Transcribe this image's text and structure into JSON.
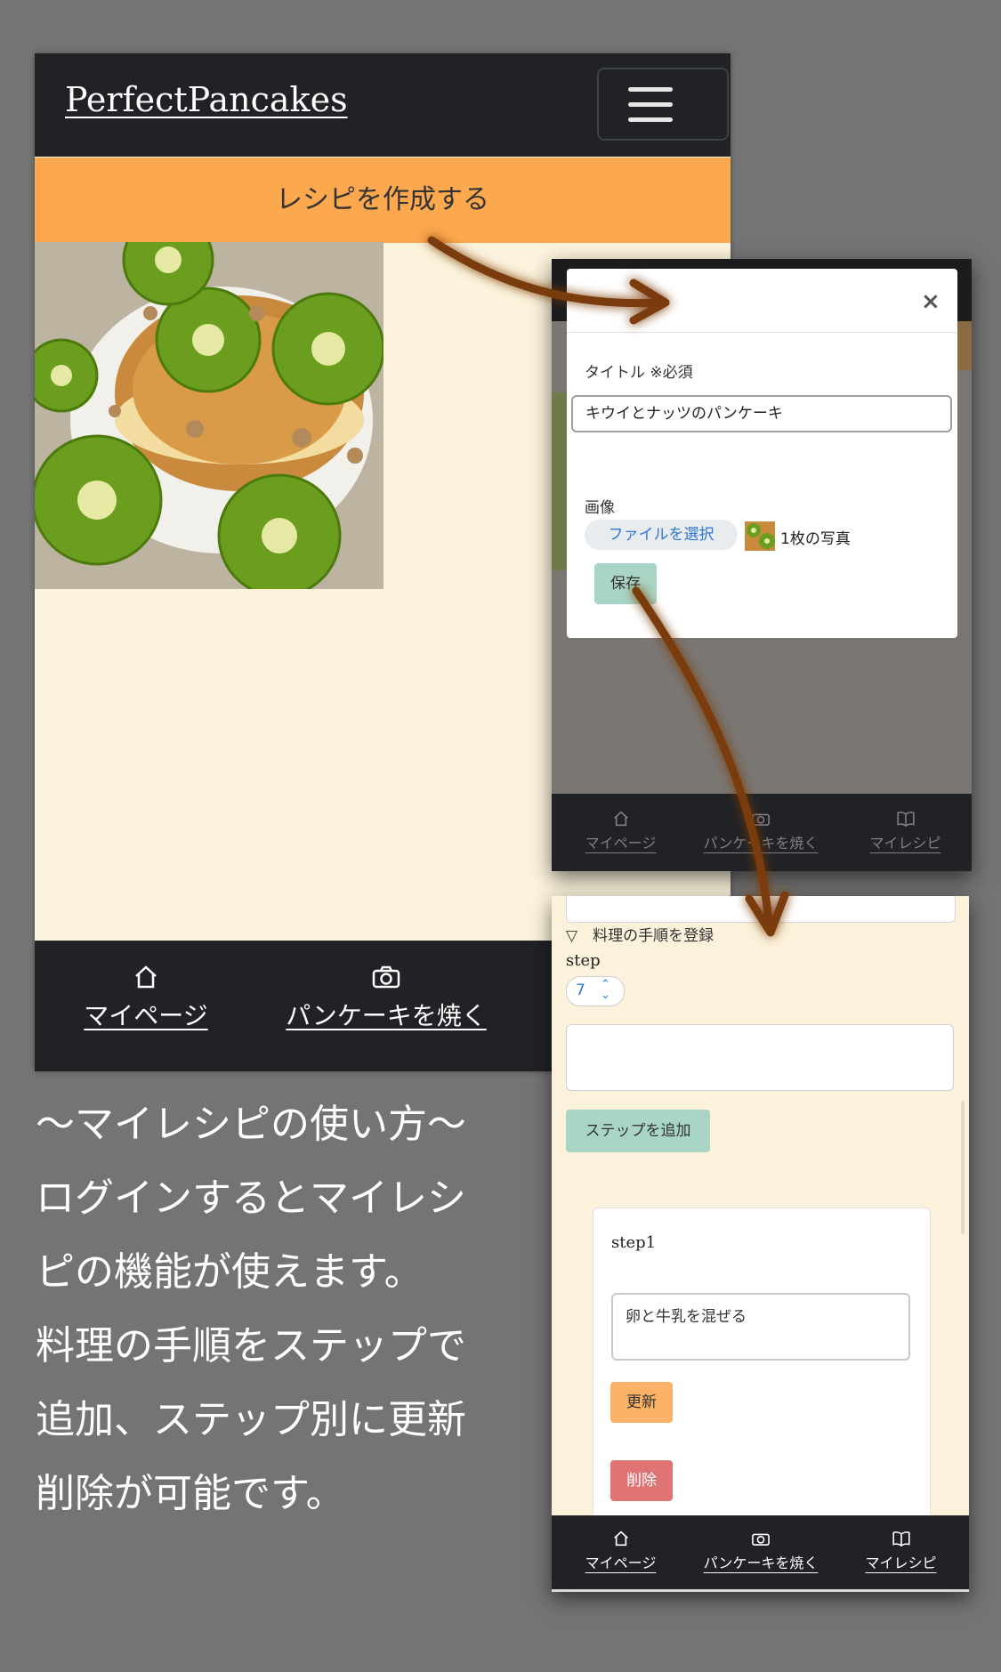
{
  "phone1": {
    "brand": "PerfectPancakes",
    "create_button": "レシピを作成する",
    "bottom_nav": {
      "mypage": "マイページ",
      "bake": "パンケーキを焼く"
    }
  },
  "phone2": {
    "modal": {
      "close": "×",
      "title_label": "タイトル ※必須",
      "title_value": "キウイとナッツのパンケーキ",
      "image_label": "画像",
      "file_button": "ファイルを選択",
      "file_count": "1枚の写真",
      "save_button": "保存"
    },
    "bottom_nav": {
      "mypage": "マイページ",
      "bake": "パンケーキを焼く",
      "myrecipe": "マイレシピ"
    }
  },
  "phone3": {
    "summary": "▽　料理の手順を登録",
    "step_label": "step",
    "step_value": "7",
    "add_step_button": "ステップを追加",
    "card": {
      "title": "step1",
      "text": "卵と牛乳を混ぜる",
      "update_button": "更新",
      "delete_button": "削除"
    },
    "bottom_nav": {
      "mypage": "マイページ",
      "bake": "パンケーキを焼く",
      "myrecipe": "マイレシピ"
    }
  },
  "caption": {
    "lines": [
      "〜マイレシピの使い方〜",
      "ログインするとマイレシ",
      "ピの機能が使えます。",
      "料理の手順をステップで",
      "追加、ステップ別に更新",
      "削除が可能です。"
    ]
  },
  "colors": {
    "navbar": "#202226",
    "accent_orange": "#fca84e",
    "cream_bg": "#fcf3dc",
    "mint_button": "#a9d5c5",
    "delete_red": "#e07474",
    "arrow_brown": "#7a3a0c"
  }
}
